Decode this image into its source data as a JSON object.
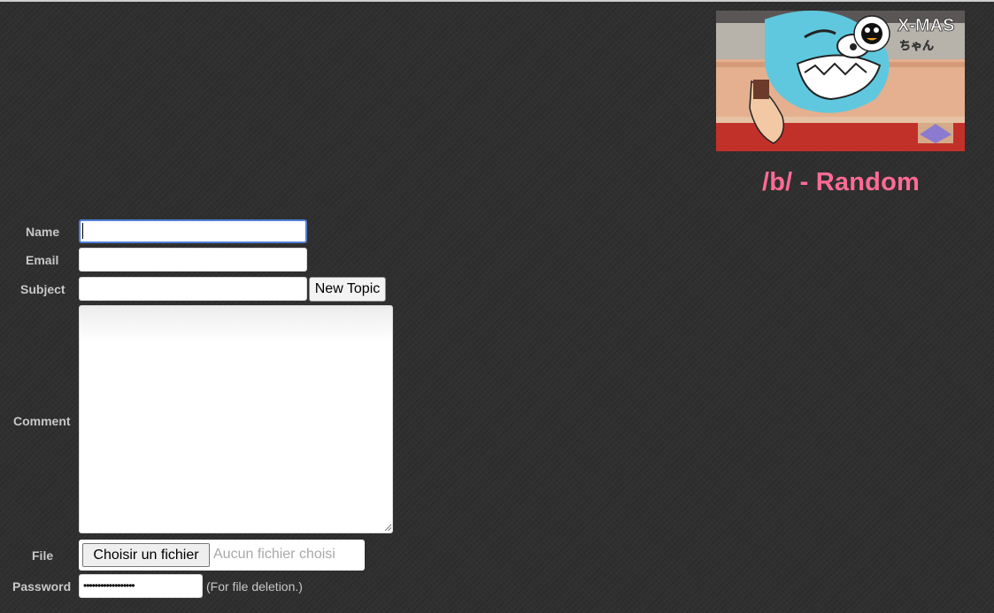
{
  "board": {
    "title": "/b/ - Random"
  },
  "banner": {
    "logo_text": "X-MAS",
    "logo_subtext": "ちゃん"
  },
  "colors": {
    "background": "#2f2f2f",
    "title_pink": "#ff6b95",
    "label_grey": "#c8c8c8",
    "focus_blue": "#4f7fd6"
  },
  "form": {
    "name_label": "Name",
    "email_label": "Email",
    "subject_label": "Subject",
    "comment_label": "Comment",
    "file_label": "File",
    "password_label": "Password",
    "name_value": "",
    "email_value": "",
    "subject_value": "",
    "comment_value": "",
    "submit_label": "New Topic",
    "file_button_label": "Choisir un fichier",
    "file_status": "Aucun fichier choisi",
    "password_mask": "••••••••••••••••••",
    "password_note": "(For file deletion.)"
  }
}
